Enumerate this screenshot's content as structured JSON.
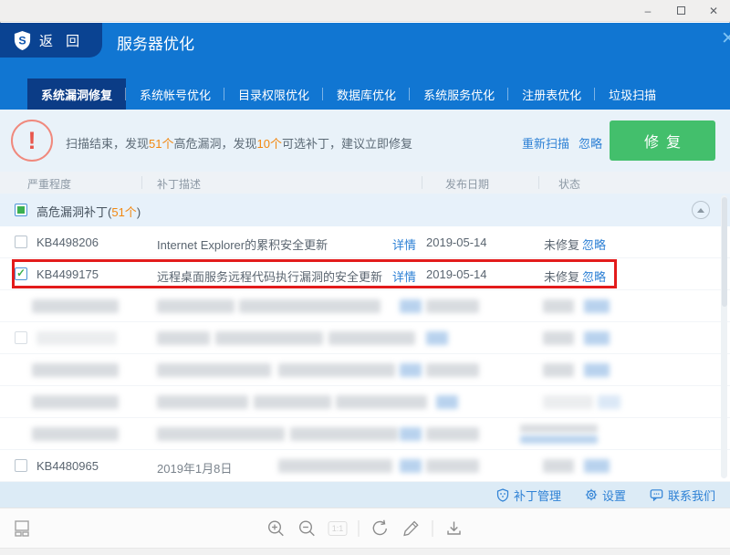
{
  "titlebar": {
    "minimize_glyph": "–",
    "close_glyph": "✕"
  },
  "header": {
    "logo_letter": "S",
    "back_label": "返 回",
    "title": "服务器优化",
    "close_glyph": "✕"
  },
  "tabs": [
    {
      "label": "系统漏洞修复",
      "active": true
    },
    {
      "label": "系统帐号优化",
      "active": false
    },
    {
      "label": "目录权限优化",
      "active": false
    },
    {
      "label": "数据库优化",
      "active": false
    },
    {
      "label": "系统服务优化",
      "active": false
    },
    {
      "label": "注册表优化",
      "active": false
    },
    {
      "label": "垃圾扫描",
      "active": false
    }
  ],
  "alert": {
    "icon": "exclamation-circle-icon",
    "icon_glyph": "!",
    "text": {
      "p1": "扫描结束，发现",
      "n1": "51个",
      "p2": "高危漏洞，发现",
      "n2": "10个",
      "p3": "可选补丁，建议立即修复"
    },
    "rescan": "重新扫描",
    "ignore": "忽略",
    "fix": "修复"
  },
  "table": {
    "columns": [
      "严重程度",
      "补丁描述",
      "发布日期",
      "状态"
    ],
    "group": {
      "prefix": "高危漏洞补丁(",
      "count": "51个",
      "suffix": ")"
    },
    "rows": [
      {
        "checked": false,
        "highlighted": false,
        "kb": "KB4498206",
        "desc": "Internet Explorer的累积安全更新",
        "detail": "详情",
        "date": "2019-05-14",
        "status": "未修复",
        "ignore": "忽略"
      },
      {
        "checked": true,
        "highlighted": true,
        "kb": "KB4499175",
        "desc": "远程桌面服务远程代码执行漏洞的安全更新",
        "detail": "详情",
        "date": "2019-05-14",
        "status": "未修复",
        "ignore": "忽略"
      }
    ],
    "last_row": {
      "checked": false,
      "kb": "KB4480965",
      "date": "2019年1月8日"
    }
  },
  "footer": {
    "links": [
      {
        "icon": "shield-icon",
        "label": "补丁管理"
      },
      {
        "icon": "gear-icon",
        "label": "设置"
      },
      {
        "icon": "chat-icon",
        "label": "联系我们"
      }
    ]
  },
  "viewer": {
    "zoom_actual_label": "1:1",
    "icons": [
      "gallery-icon",
      "zoom-in-icon",
      "zoom-out-icon",
      "zoom-actual-button",
      "rotate-icon",
      "edit-icon",
      "download-icon"
    ]
  },
  "colors": {
    "header_blue": "#1176d2",
    "active_tab_blue": "#0b3c86",
    "alert_bg": "#e9f2f9",
    "green": "#43bf6c",
    "red_highlight": "#e31b1b",
    "link_blue": "#2e81d5",
    "orange": "#f2870f"
  }
}
